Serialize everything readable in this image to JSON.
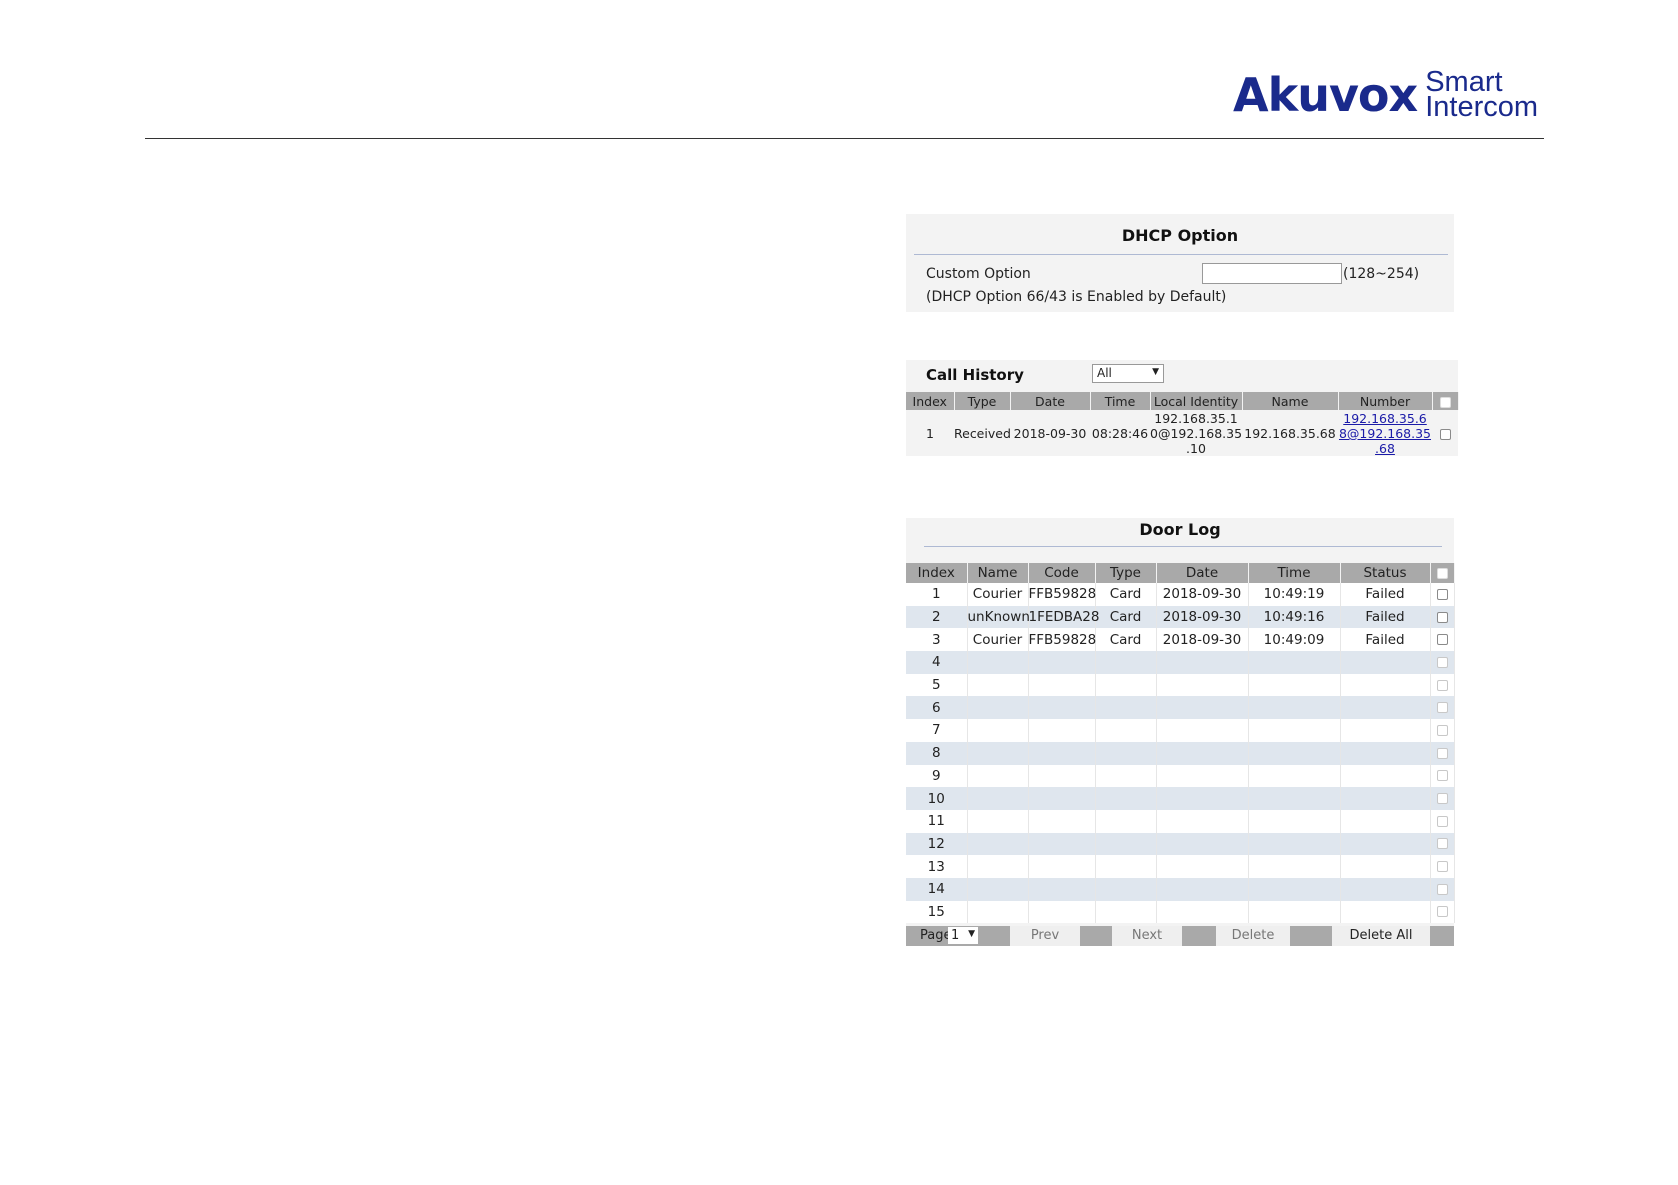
{
  "header": {
    "logo_main": "Akuvox",
    "logo_sub_line1": "Smart",
    "logo_sub_line2": "Intercom"
  },
  "dhcp": {
    "title": "DHCP Option",
    "custom_option_label": "Custom Option",
    "custom_option_value": "",
    "range": "(128~254)",
    "note": "(DHCP Option 66/43 is Enabled by Default)"
  },
  "call_history": {
    "title": "Call History",
    "filter_selected": "All",
    "columns": [
      "Index",
      "Type",
      "Date",
      "Time",
      "Local Identity",
      "Name",
      "Number"
    ],
    "rows": [
      {
        "index": "1",
        "type": "Received",
        "date": "2018-09-30",
        "time": "08:28:46",
        "local_identity": "192.168.35.1\n0@192.168.35\n.10",
        "local_identity_lines": [
          "192.168.35.1",
          "0@192.168.35",
          ".10"
        ],
        "name": "192.168.35.68",
        "number_lines": [
          "192.168.35.6",
          "8@192.168.35",
          ".68"
        ]
      }
    ]
  },
  "door_log": {
    "title": "Door Log",
    "columns": [
      "Index",
      "Name",
      "Code",
      "Type",
      "Date",
      "Time",
      "Status"
    ],
    "rows": [
      {
        "index": "1",
        "name": "Courier",
        "code": "FFB59828",
        "type": "Card",
        "date": "2018-09-30",
        "time": "10:49:19",
        "status": "Failed"
      },
      {
        "index": "2",
        "name": "unKnown",
        "code": "1FEDBA28",
        "type": "Card",
        "date": "2018-09-30",
        "time": "10:49:16",
        "status": "Failed"
      },
      {
        "index": "3",
        "name": "Courier",
        "code": "FFB59828",
        "type": "Card",
        "date": "2018-09-30",
        "time": "10:49:09",
        "status": "Failed"
      },
      {
        "index": "4",
        "name": "",
        "code": "",
        "type": "",
        "date": "",
        "time": "",
        "status": ""
      },
      {
        "index": "5",
        "name": "",
        "code": "",
        "type": "",
        "date": "",
        "time": "",
        "status": ""
      },
      {
        "index": "6",
        "name": "",
        "code": "",
        "type": "",
        "date": "",
        "time": "",
        "status": ""
      },
      {
        "index": "7",
        "name": "",
        "code": "",
        "type": "",
        "date": "",
        "time": "",
        "status": ""
      },
      {
        "index": "8",
        "name": "",
        "code": "",
        "type": "",
        "date": "",
        "time": "",
        "status": ""
      },
      {
        "index": "9",
        "name": "",
        "code": "",
        "type": "",
        "date": "",
        "time": "",
        "status": ""
      },
      {
        "index": "10",
        "name": "",
        "code": "",
        "type": "",
        "date": "",
        "time": "",
        "status": ""
      },
      {
        "index": "11",
        "name": "",
        "code": "",
        "type": "",
        "date": "",
        "time": "",
        "status": ""
      },
      {
        "index": "12",
        "name": "",
        "code": "",
        "type": "",
        "date": "",
        "time": "",
        "status": ""
      },
      {
        "index": "13",
        "name": "",
        "code": "",
        "type": "",
        "date": "",
        "time": "",
        "status": ""
      },
      {
        "index": "14",
        "name": "",
        "code": "",
        "type": "",
        "date": "",
        "time": "",
        "status": ""
      },
      {
        "index": "15",
        "name": "",
        "code": "",
        "type": "",
        "date": "",
        "time": "",
        "status": ""
      }
    ],
    "pager": {
      "page_label": "Page",
      "page_selected": "1",
      "prev_label": "Prev",
      "next_label": "Next",
      "delete_label": "Delete",
      "delete_all_label": "Delete All"
    }
  },
  "icons": {
    "dropdown": "triangle-down-icon",
    "checkbox": "checkbox-icon"
  },
  "colors": {
    "brand": "#1a2a8c",
    "table_header": "#a9a9a9",
    "row_alt": "#dfe6ee",
    "link": "#1a1aa8"
  }
}
